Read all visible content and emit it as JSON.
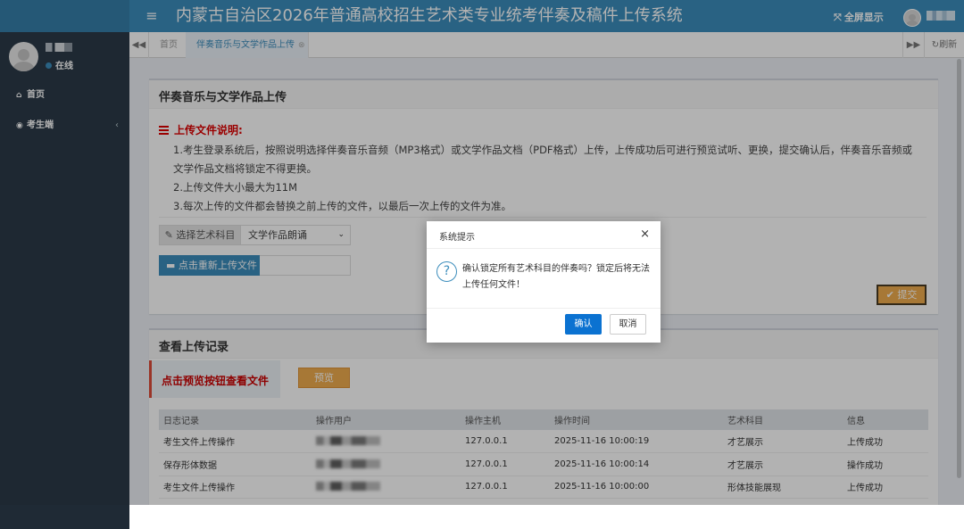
{
  "header": {
    "menu_icon": "bars-icon",
    "title": "内蒙古自治区2026年普通高校招生艺术类专业统考伴奏及稿件上传系统",
    "fullscreen_label": "全屏显示",
    "fullscreen_icon": "expand-icon"
  },
  "sidebar": {
    "status": "在线",
    "items": [
      {
        "label": "首页",
        "icon": "home-icon"
      },
      {
        "label": "考生端",
        "icon": "user-circle-icon",
        "chevron": "‹"
      }
    ]
  },
  "tabs": {
    "home": "首页",
    "active": "伴奏音乐与文学作品上传",
    "refresh": "刷新"
  },
  "upload_box": {
    "title": "伴奏音乐与文学作品上传",
    "notes_title": "上传文件说明:",
    "notes": [
      "1.考生登录系统后，按照说明选择伴奏音乐音频（MP3格式）或文学作品文档（PDF格式）上传，上传成功后可进行预览试听、更换，提交确认后，伴奏音乐音频或",
      "文学作品文档将锁定不得更换。",
      "2.上传文件大小最大为11M",
      "3.每次上传的文件都会替换之前上传的文件，以最后一次上传的文件为准。"
    ],
    "select_addon": "选择艺术科目",
    "select_value": "文学作品朗诵",
    "reupload_label": "点击重新上传文件",
    "submit_label": "提交"
  },
  "records_box": {
    "title": "查看上传记录",
    "banner": "点击预览按钮查看文件",
    "preview_label": "预览",
    "columns": [
      "日志记录",
      "操作用户",
      "操作主机",
      "操作时间",
      "艺术科目",
      "信息"
    ],
    "rows": [
      {
        "log": "考生文件上传操作",
        "host": "127.0.0.1",
        "time": "2025-11-16 10:00:19",
        "subject": "才艺展示",
        "info": "上传成功"
      },
      {
        "log": "保存形体数据",
        "host": "127.0.0.1",
        "time": "2025-11-16 10:00:14",
        "subject": "才艺展示",
        "info": "操作成功"
      },
      {
        "log": "考生文件上传操作",
        "host": "127.0.0.1",
        "time": "2025-11-16 10:00:00",
        "subject": "形体技能展现",
        "info": "上传成功"
      }
    ]
  },
  "modal": {
    "title": "系统提示",
    "message": "确认锁定所有艺术科目的伴奏吗？锁定后将无法上传任何文件！",
    "ok_label": "确认",
    "cancel_label": "取消"
  },
  "colors": {
    "header": "#3c8dbc",
    "sidebar": "#2b3a48",
    "warning": "#f0ad4e",
    "primary": "#0b72d1",
    "danger_text": "#dd0000"
  }
}
